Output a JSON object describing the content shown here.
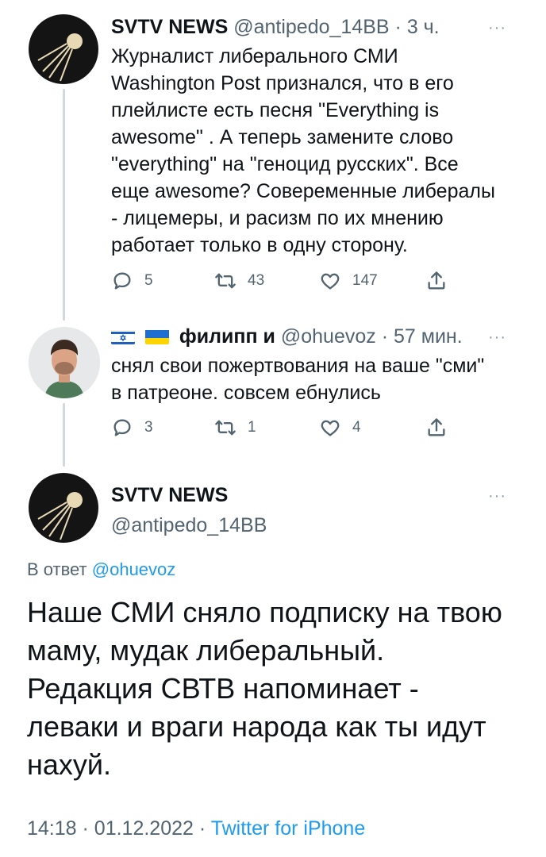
{
  "tweet1": {
    "name": "SVTV NEWS",
    "handle": "@antipedo_14BB",
    "separator": "·",
    "time": "3 ч.",
    "text": "Журналист либерального СМИ\nWashington Post признался, что в его\nплейлисте есть песня \"Everything is\nawesome\" . А теперь замените слово\n\"everything\" на \"геноцид русских\". Все\nеще awesome? Совеременные либералы\n- лицемеры, и расизм по их мнению\nработает только в одну сторону.",
    "replies": "5",
    "retweets": "43",
    "likes": "147",
    "more": "···"
  },
  "tweet2": {
    "name": "филипп и",
    "handle": "@ohuevoz",
    "separator": "·",
    "time": "57 мин.",
    "text": "снял свои пожертвования на ваше \"сми\"\nв патреоне. совсем ебнулись",
    "replies": "3",
    "retweets": "1",
    "likes": "4",
    "more": "···"
  },
  "main_tweet": {
    "name": "SVTV NEWS",
    "handle": "@antipedo_14BB",
    "more": "···",
    "reply_prefix": "В ответ",
    "reply_to": "@ohuevoz",
    "text": "Наше СМИ сняло подписку на твою\nмаму, мудак либеральный.\nРедакция СВТВ напоминает -\nлеваки и враги народа как ты идут\nнахуй.",
    "time": "14:18",
    "dot1": "·",
    "date": "01.12.2022",
    "dot2": "·",
    "source": "Twitter for iPhone"
  },
  "colors": {
    "link": "#1d9bf0",
    "muted": "#536471",
    "thread_line": "#cfd9de"
  },
  "icons": [
    "satellite-icon",
    "reply-icon",
    "retweet-icon",
    "like-icon",
    "share-icon",
    "israel-flag-icon",
    "ukraine-flag-icon"
  ]
}
